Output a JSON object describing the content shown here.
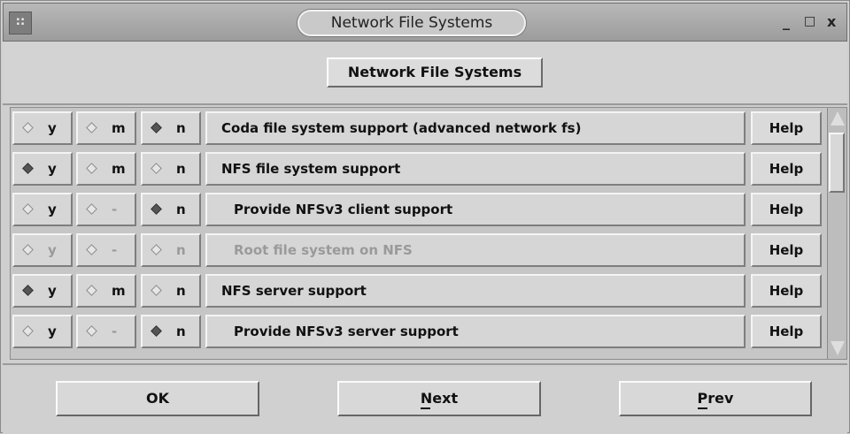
{
  "window": {
    "title": "Network File Systems",
    "menu_glyph": "::",
    "controls": {
      "minimize": "_",
      "maximize": "□",
      "close": "x"
    }
  },
  "header": {
    "button_label": "Network File Systems"
  },
  "options": [
    {
      "y": "y",
      "m": "m",
      "n": "n",
      "selected": "n",
      "enabled": true,
      "m_available": true,
      "indent": false,
      "label": "Coda file system support (advanced network fs)",
      "help": "Help"
    },
    {
      "y": "y",
      "m": "m",
      "n": "n",
      "selected": "y",
      "enabled": true,
      "m_available": true,
      "indent": false,
      "label": "NFS file system support",
      "help": "Help"
    },
    {
      "y": "y",
      "m": "-",
      "n": "n",
      "selected": "n",
      "enabled": true,
      "m_available": false,
      "indent": true,
      "label": "Provide NFSv3 client support",
      "help": "Help"
    },
    {
      "y": "y",
      "m": "-",
      "n": "n",
      "selected": "none",
      "enabled": false,
      "m_available": false,
      "indent": true,
      "label": "Root file system on NFS",
      "help": "Help"
    },
    {
      "y": "y",
      "m": "m",
      "n": "n",
      "selected": "y",
      "enabled": true,
      "m_available": true,
      "indent": false,
      "label": "NFS server support",
      "help": "Help"
    },
    {
      "y": "y",
      "m": "-",
      "n": "n",
      "selected": "n",
      "enabled": true,
      "m_available": false,
      "indent": true,
      "label": "Provide NFSv3 server support",
      "help": "Help"
    }
  ],
  "buttons": {
    "ok": "OK",
    "next": "Next",
    "prev": "Prev"
  },
  "colors": {
    "window_bg": "#cfcfcf",
    "selected_diamond": "#555555",
    "disabled_text": "#9a9a9a"
  }
}
